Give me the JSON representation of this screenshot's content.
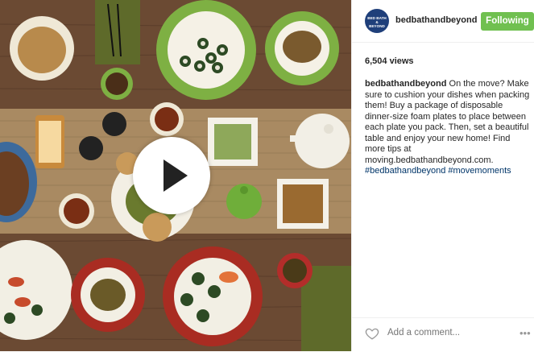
{
  "post": {
    "username": "bedbathandbeyond",
    "follow_label": "Following",
    "avatar_text": "BED BATH & BEYOND",
    "views": "6,504 views",
    "caption_user": "bedbathandbeyond",
    "caption_text": " On the move? Make sure to cushion your dishes when packing them! Buy a package of disposable dinner-size foam plates to place between each plate you pack. Then, set a beautiful table and enjoy your new home! Find more tips at moving.bedbathandbeyond.com.",
    "hashtag_1": "#bedbathandbeyond",
    "hashtag_2": "#movemoments",
    "comment_placeholder": "Add a comment...",
    "more_label": "•••"
  },
  "colors": {
    "follow_green": "#70c050",
    "avatar_blue": "#1f3f7a",
    "link_blue": "#003569"
  },
  "icons": {
    "play": "play-icon",
    "heart": "heart-icon",
    "more": "more-options-icon"
  }
}
